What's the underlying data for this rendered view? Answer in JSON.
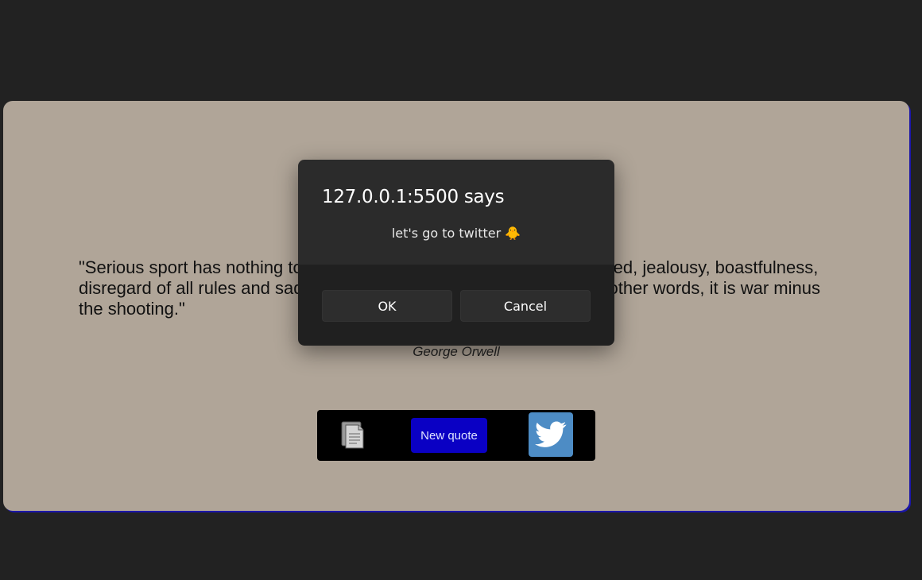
{
  "quote": {
    "text": "\"Serious sport has nothing to do with fair play. It is bound up with hatred, jealousy, boastfulness, disregard of all rules and sadistic pleasure in witnessing violence. In other words, it is war minus the shooting.\"",
    "author": "George Orwell"
  },
  "toolbar": {
    "copy_icon": "document-icon",
    "new_quote_label": "New quote",
    "twitter_icon": "twitter-bird-icon"
  },
  "dialog": {
    "title": "127.0.0.1:5500 says",
    "message": "let's go to twitter 🐥",
    "ok_label": "OK",
    "cancel_label": "Cancel"
  },
  "colors": {
    "page_bg": "#222222",
    "card_bg": "#b0a598",
    "new_quote_bg": "#0a00c4",
    "twitter_bg": "#4d8cc5",
    "dialog_bg": "#2b2b2b"
  }
}
